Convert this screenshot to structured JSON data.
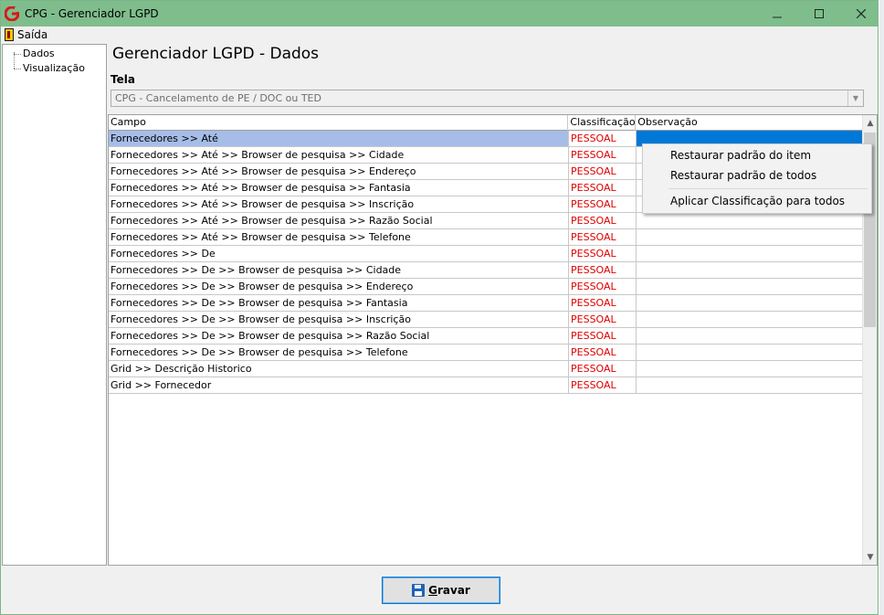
{
  "window": {
    "title": "CPG - Gerenciador LGPD",
    "minimize_icon": "minimize-icon",
    "maximize_icon": "maximize-icon",
    "close_icon": "close-icon",
    "title_color": "#7fbd8c"
  },
  "menu": {
    "exit_label": "Saída",
    "exit_icon": "door-exit-icon"
  },
  "tree": {
    "items": [
      {
        "label": "Dados"
      },
      {
        "label": "Visualização"
      }
    ]
  },
  "main": {
    "title": "Gerenciador LGPD - Dados",
    "tela_label": "Tela",
    "tela_value": "CPG - Cancelamento de PE / DOC ou TED"
  },
  "grid": {
    "columns": [
      "Campo",
      "Classificação",
      "Observação"
    ],
    "rows": [
      {
        "campo": "Fornecedores >> Até",
        "classificacao": "PESSOAL",
        "observacao": ""
      },
      {
        "campo": "Fornecedores >> Até >> Browser de pesquisa >> Cidade",
        "classificacao": "PESSOAL",
        "observacao": ""
      },
      {
        "campo": "Fornecedores >> Até >> Browser de pesquisa >> Endereço",
        "classificacao": "PESSOAL",
        "observacao": ""
      },
      {
        "campo": "Fornecedores >> Até >> Browser de pesquisa >> Fantasia",
        "classificacao": "PESSOAL",
        "observacao": ""
      },
      {
        "campo": "Fornecedores >> Até >> Browser de pesquisa >> Inscrição",
        "classificacao": "PESSOAL",
        "observacao": ""
      },
      {
        "campo": "Fornecedores >> Até >> Browser de pesquisa >> Razão Social",
        "classificacao": "PESSOAL",
        "observacao": ""
      },
      {
        "campo": "Fornecedores >> Até >> Browser de pesquisa >> Telefone",
        "classificacao": "PESSOAL",
        "observacao": ""
      },
      {
        "campo": "Fornecedores >> De",
        "classificacao": "PESSOAL",
        "observacao": ""
      },
      {
        "campo": "Fornecedores >> De >> Browser de pesquisa >> Cidade",
        "classificacao": "PESSOAL",
        "observacao": ""
      },
      {
        "campo": "Fornecedores >> De >> Browser de pesquisa >> Endereço",
        "classificacao": "PESSOAL",
        "observacao": ""
      },
      {
        "campo": "Fornecedores >> De >> Browser de pesquisa >> Fantasia",
        "classificacao": "PESSOAL",
        "observacao": ""
      },
      {
        "campo": "Fornecedores >> De >> Browser de pesquisa >> Inscrição",
        "classificacao": "PESSOAL",
        "observacao": ""
      },
      {
        "campo": "Fornecedores >> De >> Browser de pesquisa >> Razão Social",
        "classificacao": "PESSOAL",
        "observacao": ""
      },
      {
        "campo": "Fornecedores >> De >> Browser de pesquisa >> Telefone",
        "classificacao": "PESSOAL",
        "observacao": ""
      },
      {
        "campo": "Grid >> Descrição Historico",
        "classificacao": "PESSOAL",
        "observacao": ""
      },
      {
        "campo": "Grid >> Fornecedor",
        "classificacao": "PESSOAL",
        "observacao": ""
      }
    ],
    "classification_color": "#e00000",
    "selected_row_color": "#a6bde8",
    "selected_cell_color": "#0078d7"
  },
  "context_menu": {
    "items": [
      {
        "label": "Restaurar padrão do item"
      },
      {
        "label": "Restaurar padrão de todos"
      },
      {
        "label": "Aplicar Classificação para todos"
      }
    ]
  },
  "footer": {
    "save_label": "Gravar",
    "save_icon": "floppy-disk-icon"
  }
}
